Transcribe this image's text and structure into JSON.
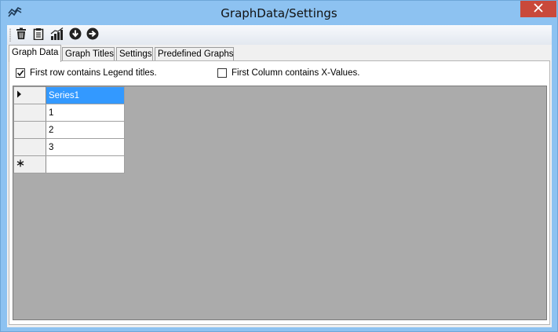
{
  "window": {
    "title": "GraphData/Settings",
    "app_icon": "chart-line-icon",
    "close_icon": "close-icon",
    "colors": {
      "titlebar": "#8dc2f1",
      "close": "#c9493b",
      "selection": "#3399ff",
      "grid_background": "#ababab"
    }
  },
  "toolbar": {
    "buttons": [
      {
        "name": "trash-icon"
      },
      {
        "name": "clipboard-icon"
      },
      {
        "name": "bar-chart-icon"
      },
      {
        "name": "arrow-down-circle-icon"
      },
      {
        "name": "arrow-right-circle-icon"
      }
    ]
  },
  "tabs": [
    {
      "label": "Graph Data",
      "active": true
    },
    {
      "label": "Graph Titles",
      "active": false
    },
    {
      "label": "Settings",
      "active": false
    },
    {
      "label": "Predefined Graphs",
      "active": false
    }
  ],
  "options": {
    "first_row_legend": {
      "label": "First row contains Legend titles.",
      "checked": true
    },
    "first_column_x": {
      "label": "First Column contains X-Values.",
      "checked": false
    }
  },
  "grid": {
    "rows": [
      {
        "marker": "current-row-arrow-icon",
        "value": "Series1",
        "selected": true
      },
      {
        "marker": "",
        "value": "1"
      },
      {
        "marker": "",
        "value": "2"
      },
      {
        "marker": "",
        "value": "3"
      },
      {
        "marker": "new-row-asterisk-icon",
        "value": ""
      }
    ]
  }
}
